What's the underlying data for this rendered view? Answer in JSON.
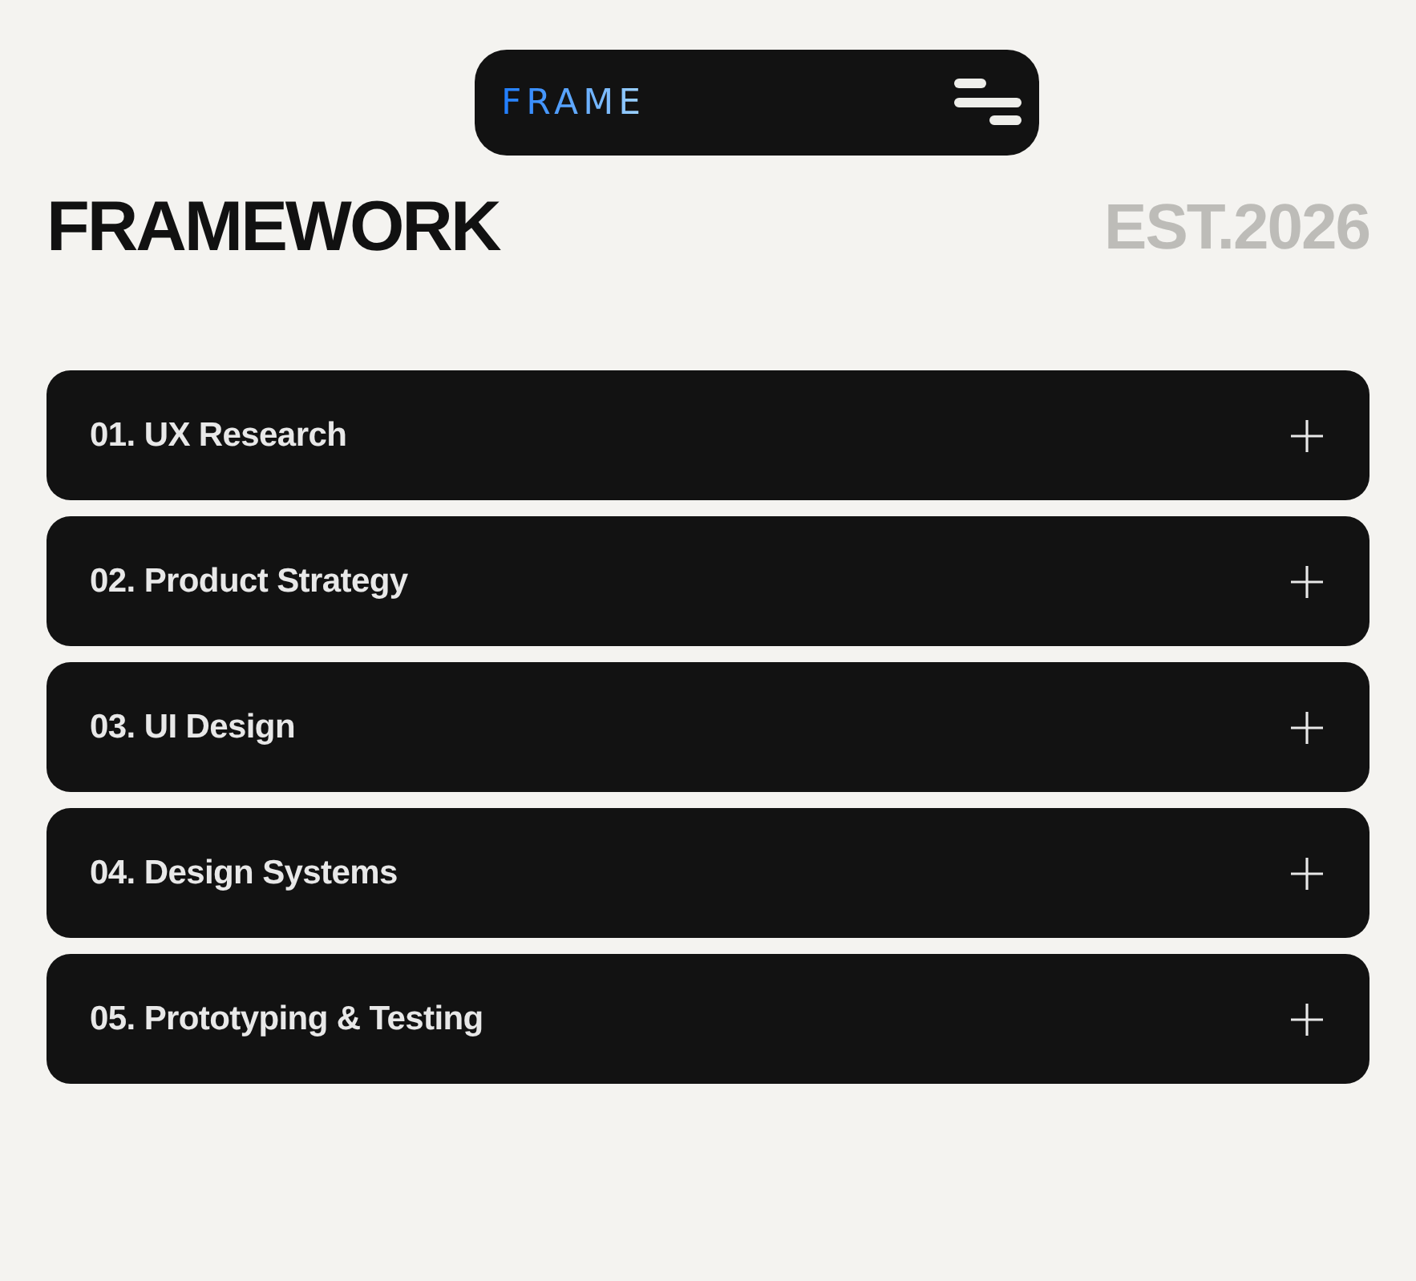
{
  "navbar": {
    "logo": "FRAME"
  },
  "heading": {
    "title": "FRAMEWORK",
    "est": "EST.2026"
  },
  "accordion": [
    {
      "label": "01. UX Research",
      "expanded": false
    },
    {
      "label": "02. Product Strategy",
      "expanded": false
    },
    {
      "label": "03. UI Design",
      "expanded": false
    },
    {
      "label": "04. Design Systems",
      "expanded": false
    },
    {
      "label": "05. Prototyping & Testing",
      "expanded": false
    }
  ]
}
